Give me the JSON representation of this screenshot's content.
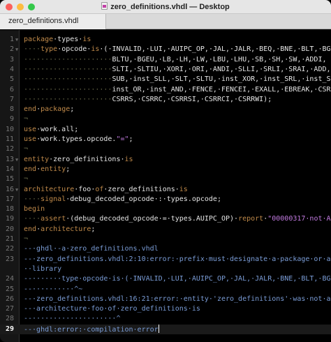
{
  "window": {
    "title": "zero_definitions.vhdl — Desktop",
    "tab": "zero_definitions.vhdl"
  },
  "editor": {
    "current_line": 29,
    "lines": [
      {
        "n": "1",
        "parts": [
          [
            "kw",
            "package"
          ],
          [
            "",
            "·types·"
          ],
          [
            "kw",
            "is"
          ]
        ]
      },
      {
        "n": "2",
        "parts": [
          [
            "dot",
            "····"
          ],
          [
            "kw",
            "type"
          ],
          [
            "",
            "·opcode·"
          ],
          [
            "kw",
            "is"
          ],
          [
            "",
            "·(·INVALID,·LUI,·AUIPC_OP,·JAL,·JALR,·BEQ,·BNE,·BLT,·BGE,"
          ]
        ]
      },
      {
        "n": "3",
        "parts": [
          [
            "dot",
            "·····················"
          ],
          [
            "",
            "BLTU,·BGEU,·LB,·LH,·LW,·LBU,·LHU,·SB,·SH,·SW,·ADDI,"
          ]
        ]
      },
      {
        "n": "4",
        "parts": [
          [
            "dot",
            "·····················"
          ],
          [
            "",
            "SLTI,·SLTIU,·XORI,·ORI,·ANDI,·SLLI,·SRLI,·SRAI,·ADD,"
          ]
        ]
      },
      {
        "n": "5",
        "parts": [
          [
            "dot",
            "·····················"
          ],
          [
            "",
            "SUB,·inst_SLL,·SLT,·SLTU,·inst_XOR,·inst_SRL,·inst_SRA,"
          ]
        ]
      },
      {
        "n": "6",
        "parts": [
          [
            "dot",
            "·····················"
          ],
          [
            "",
            "inst_OR,·inst_AND,·FENCE,·FENCEI,·EXALL,·EBREAK,·CSRRW,"
          ]
        ]
      },
      {
        "n": "7",
        "parts": [
          [
            "dot",
            "·····················"
          ],
          [
            "",
            "CSRRS,·CSRRC,·CSRRSI,·CSRRCI,·CSRRWI);"
          ]
        ]
      },
      {
        "n": "8",
        "parts": [
          [
            "kw",
            "end"
          ],
          [
            "",
            "·"
          ],
          [
            "kw",
            "package"
          ],
          [
            "",
            ";"
          ]
        ]
      },
      {
        "n": "9",
        "parts": [
          [
            "dot",
            "¬"
          ]
        ]
      },
      {
        "n": "10",
        "parts": [
          [
            "kw",
            "use"
          ],
          [
            "",
            "·work.all;"
          ]
        ]
      },
      {
        "n": "11",
        "parts": [
          [
            "kw",
            "use"
          ],
          [
            "",
            "·work.types.opcode."
          ],
          [
            "str",
            "\"=\""
          ],
          [
            "",
            ";"
          ]
        ]
      },
      {
        "n": "12",
        "parts": [
          [
            "dot",
            "¬"
          ]
        ]
      },
      {
        "n": "13",
        "parts": [
          [
            "kw",
            "entity"
          ],
          [
            "",
            "·zero_definitions·"
          ],
          [
            "kw",
            "is"
          ]
        ]
      },
      {
        "n": "14",
        "parts": [
          [
            "kw",
            "end"
          ],
          [
            "",
            "·"
          ],
          [
            "kw",
            "entity"
          ],
          [
            "",
            ";"
          ]
        ]
      },
      {
        "n": "15",
        "parts": [
          [
            "dot",
            "¬"
          ]
        ]
      },
      {
        "n": "16",
        "parts": [
          [
            "kw",
            "architecture"
          ],
          [
            "",
            "·foo·"
          ],
          [
            "kw",
            "of"
          ],
          [
            "",
            "·zero_definitions·"
          ],
          [
            "kw",
            "is"
          ]
        ]
      },
      {
        "n": "17",
        "parts": [
          [
            "dot",
            "····"
          ],
          [
            "kw",
            "signal"
          ],
          [
            "",
            "·debug_decoded_opcode·:·types.opcode;"
          ]
        ]
      },
      {
        "n": "18",
        "parts": [
          [
            "kw",
            "begin"
          ]
        ]
      },
      {
        "n": "19",
        "parts": [
          [
            "dot",
            "····"
          ],
          [
            "kw",
            "assert"
          ],
          [
            "",
            "·(debug_decoded_opcode·=·types.AUIPC_OP)·"
          ],
          [
            "kw",
            "report"
          ],
          [
            "",
            "·"
          ],
          [
            "str",
            "\"00000317·not·AUIPC\""
          ],
          [
            "",
            ";"
          ]
        ]
      },
      {
        "n": "20",
        "parts": [
          [
            "kw",
            "end"
          ],
          [
            "",
            "·"
          ],
          [
            "kw",
            "architecture"
          ],
          [
            "",
            ";"
          ]
        ]
      },
      {
        "n": "21",
        "parts": [
          [
            "dot",
            "¬"
          ]
        ]
      },
      {
        "n": "22",
        "parts": [
          [
            "com",
            "--·ghdl·-a·zero_definitions.vhdl"
          ]
        ]
      },
      {
        "n": "23",
        "parts": [
          [
            "com",
            "--·zero_definitions.vhdl:2:10:error:·prefix·must·designate·a·package·or·a·"
          ]
        ]
      },
      {
        "n": "",
        "parts": [
          [
            "com",
            "··library"
          ]
        ]
      },
      {
        "n": "24",
        "parts": [
          [
            "com",
            "--·······type·opcode·is·(·INVALID,·LUI,·AUIPC_OP,·JAL,·JALR,·BNE,·BLT,·BGE,"
          ]
        ]
      },
      {
        "n": "25",
        "parts": [
          [
            "com",
            "--··········^~"
          ]
        ]
      },
      {
        "n": "26",
        "parts": [
          [
            "com",
            "--·zero_definitions.vhdl:16:21:error:·entity·'zero_definitions'·was·not·analysed"
          ]
        ]
      },
      {
        "n": "27",
        "parts": [
          [
            "com",
            "--·architecture·foo·of·zero_definitions·is"
          ]
        ]
      },
      {
        "n": "28",
        "parts": [
          [
            "com",
            "--····················^"
          ]
        ]
      },
      {
        "n": "29",
        "parts": [
          [
            "com",
            "--·ghdl:error:·compilation·error"
          ]
        ]
      }
    ]
  }
}
